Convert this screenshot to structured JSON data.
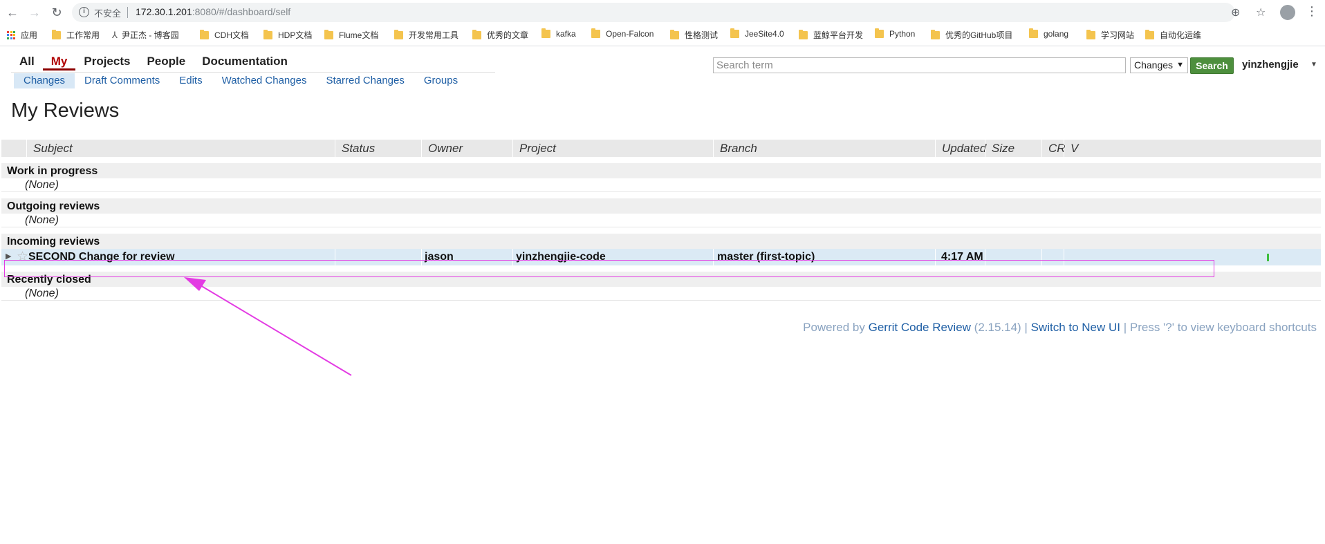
{
  "browser": {
    "insecure_label": "不安全",
    "url_host": "172.30.1.201",
    "url_rest": ":8080/#/dashboard/self",
    "bookmarks": [
      {
        "label": "应用",
        "icon": "apps-grid-icon"
      },
      {
        "label": "工作常用",
        "icon": "folder-icon"
      },
      {
        "label": "尹正杰 - 博客园",
        "icon": "person-icon"
      },
      {
        "label": "CDH文档",
        "icon": "folder-icon"
      },
      {
        "label": "HDP文档",
        "icon": "folder-icon"
      },
      {
        "label": "Flume文档",
        "icon": "folder-icon"
      },
      {
        "label": "开发常用工具",
        "icon": "folder-icon"
      },
      {
        "label": "优秀的文章",
        "icon": "folder-icon"
      },
      {
        "label": "kafka",
        "icon": "folder-icon"
      },
      {
        "label": "Open-Falcon",
        "icon": "folder-icon"
      },
      {
        "label": "性格测试",
        "icon": "folder-icon"
      },
      {
        "label": "JeeSite4.0",
        "icon": "folder-icon"
      },
      {
        "label": "蓝鲸平台开发",
        "icon": "folder-icon"
      },
      {
        "label": "Python",
        "icon": "folder-icon"
      },
      {
        "label": "优秀的GitHub项目",
        "icon": "folder-icon"
      },
      {
        "label": "golang",
        "icon": "folder-icon"
      },
      {
        "label": "学习网站",
        "icon": "folder-icon"
      },
      {
        "label": "自动化运维",
        "icon": "folder-icon"
      }
    ]
  },
  "top_menu": [
    {
      "label": "All",
      "active": false
    },
    {
      "label": "My",
      "active": true
    },
    {
      "label": "Projects",
      "active": false
    },
    {
      "label": "People",
      "active": false
    },
    {
      "label": "Documentation",
      "active": false
    }
  ],
  "sub_menu": [
    {
      "label": "Changes",
      "active": true
    },
    {
      "label": "Draft Comments",
      "active": false
    },
    {
      "label": "Edits",
      "active": false
    },
    {
      "label": "Watched Changes",
      "active": false
    },
    {
      "label": "Starred Changes",
      "active": false
    },
    {
      "label": "Groups",
      "active": false
    }
  ],
  "search": {
    "placeholder": "Search term",
    "scope": "Changes",
    "button": "Search"
  },
  "user": "yinzhengjie",
  "page_title": "My Reviews",
  "table": {
    "columns": [
      "Subject",
      "Status",
      "Owner",
      "Project",
      "Branch",
      "Updated",
      "Size",
      "CR",
      "V"
    ],
    "sections": [
      {
        "title": "Work in progress",
        "rows": [],
        "empty": "(None)"
      },
      {
        "title": "Outgoing reviews",
        "rows": [],
        "empty": "(None)"
      },
      {
        "title": "Incoming reviews",
        "rows": [
          {
            "subject": "SECOND Change for review",
            "status": "",
            "owner": "jason",
            "project": "yinzhengjie-code",
            "branch": "master (first-topic)",
            "updated": "4:17 AM",
            "size": "",
            "cr": "",
            "v": ""
          }
        ],
        "empty": ""
      },
      {
        "title": "Recently closed",
        "rows": [],
        "empty": "(None)"
      }
    ]
  },
  "footer": {
    "prefix": "Powered by ",
    "gerrit_link": "Gerrit Code Review",
    "version": " (2.15.14) | ",
    "new_ui_link": "Switch to New UI",
    "shortcuts": " | Press '?' to view keyboard shortcuts"
  },
  "colors": {
    "accent_red": "#8b0000",
    "link_blue": "#1f5fa5",
    "search_green": "#4d8f3d",
    "annotation_magenta": "#e33be3",
    "row_highlight": "#dbeaf5"
  }
}
